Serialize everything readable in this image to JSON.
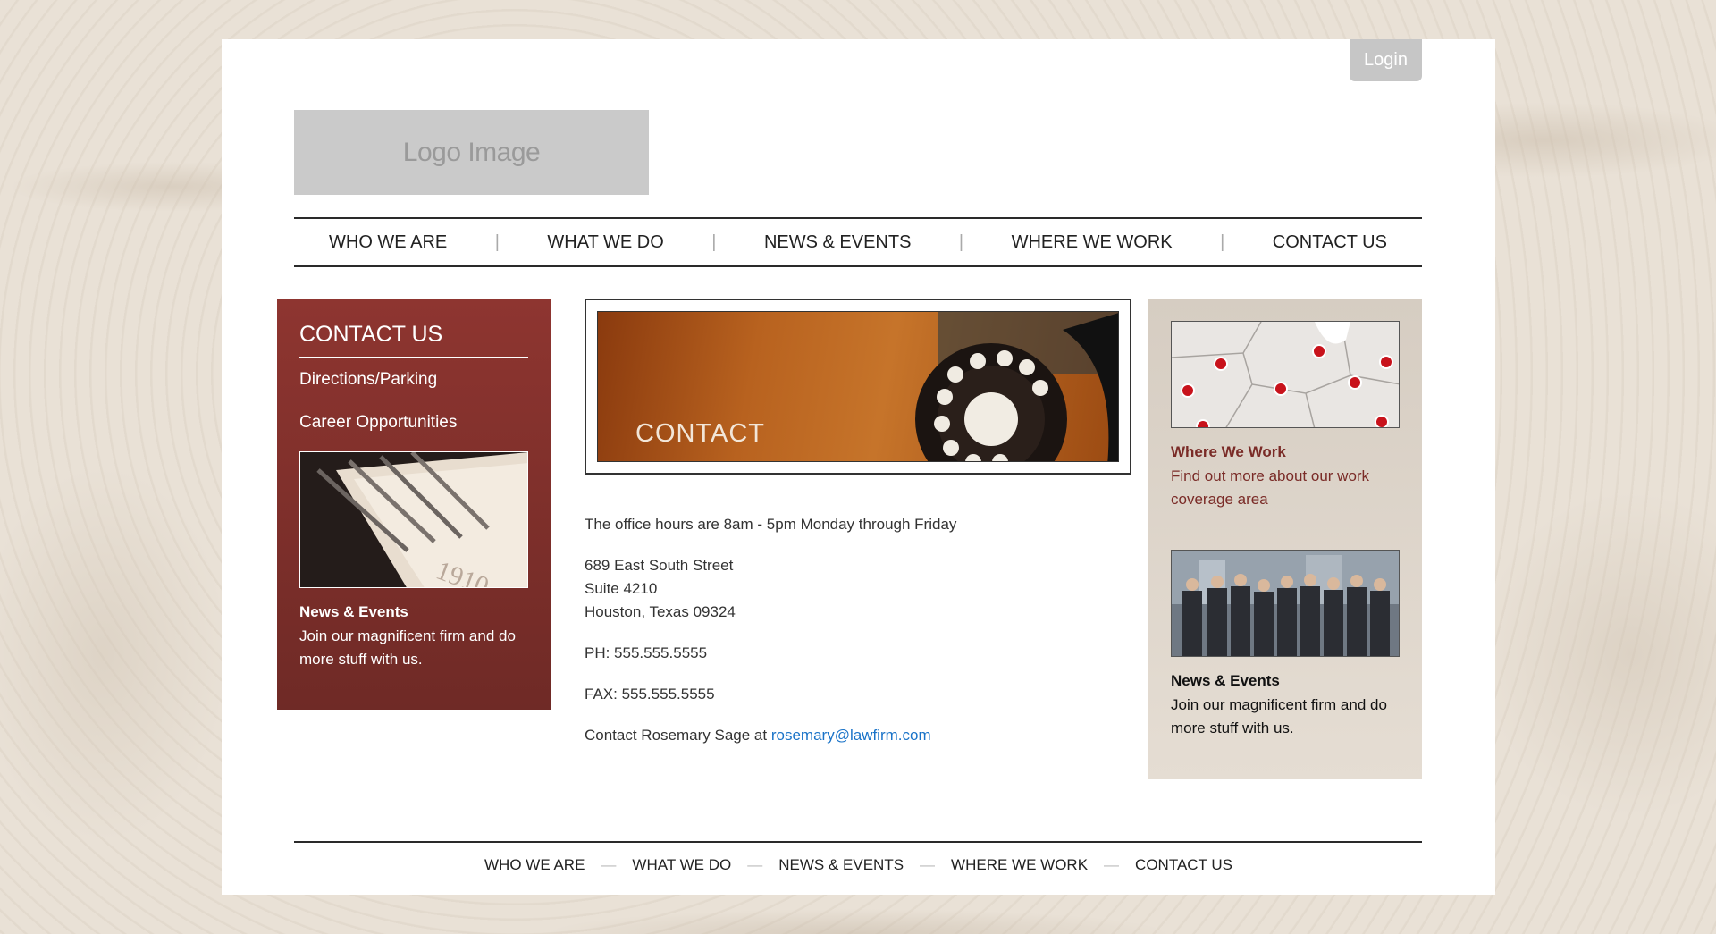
{
  "header": {
    "login_label": "Login",
    "logo_text": "Logo Image"
  },
  "nav": {
    "items": [
      "WHO WE ARE",
      "WHAT WE DO",
      "NEWS & EVENTS",
      "WHERE WE WORK",
      "CONTACT US"
    ],
    "separator": "|"
  },
  "left_panel": {
    "title": "CONTACT US",
    "links": [
      "Directions/Parking",
      "Career Opportunities"
    ],
    "feature_title": "News & Events",
    "feature_text": "Join our magnificent firm and do more stuff with us."
  },
  "hero": {
    "label": "CONTACT"
  },
  "main": {
    "hours": "The office hours are 8am - 5pm Monday through Friday",
    "address_line1": "689 East South Street",
    "address_line2": "Suite 4210",
    "address_line3": "Houston, Texas 09324",
    "phone": "PH: 555.555.5555",
    "fax": "FAX: 555.555.5555",
    "contact_prefix": "Contact Rosemary Sage at",
    "contact_email": "rosemary@lawfirm.com"
  },
  "right_panel": {
    "card1_title": "Where We Work",
    "card1_text": "Find out more about our work coverage area",
    "card2_title": "News & Events",
    "card2_text": "Join our magnificent firm and do more stuff with us."
  },
  "footer": {
    "items": [
      "WHO WE ARE",
      "WHAT WE DO",
      "NEWS & EVENTS",
      "WHERE WE WORK",
      "CONTACT US"
    ],
    "separator": "—"
  },
  "colors": {
    "left_panel": "#8e3530",
    "right_panel": "#d6cdc2",
    "accent_text": "#7a2b27",
    "link": "#1a73c8"
  }
}
